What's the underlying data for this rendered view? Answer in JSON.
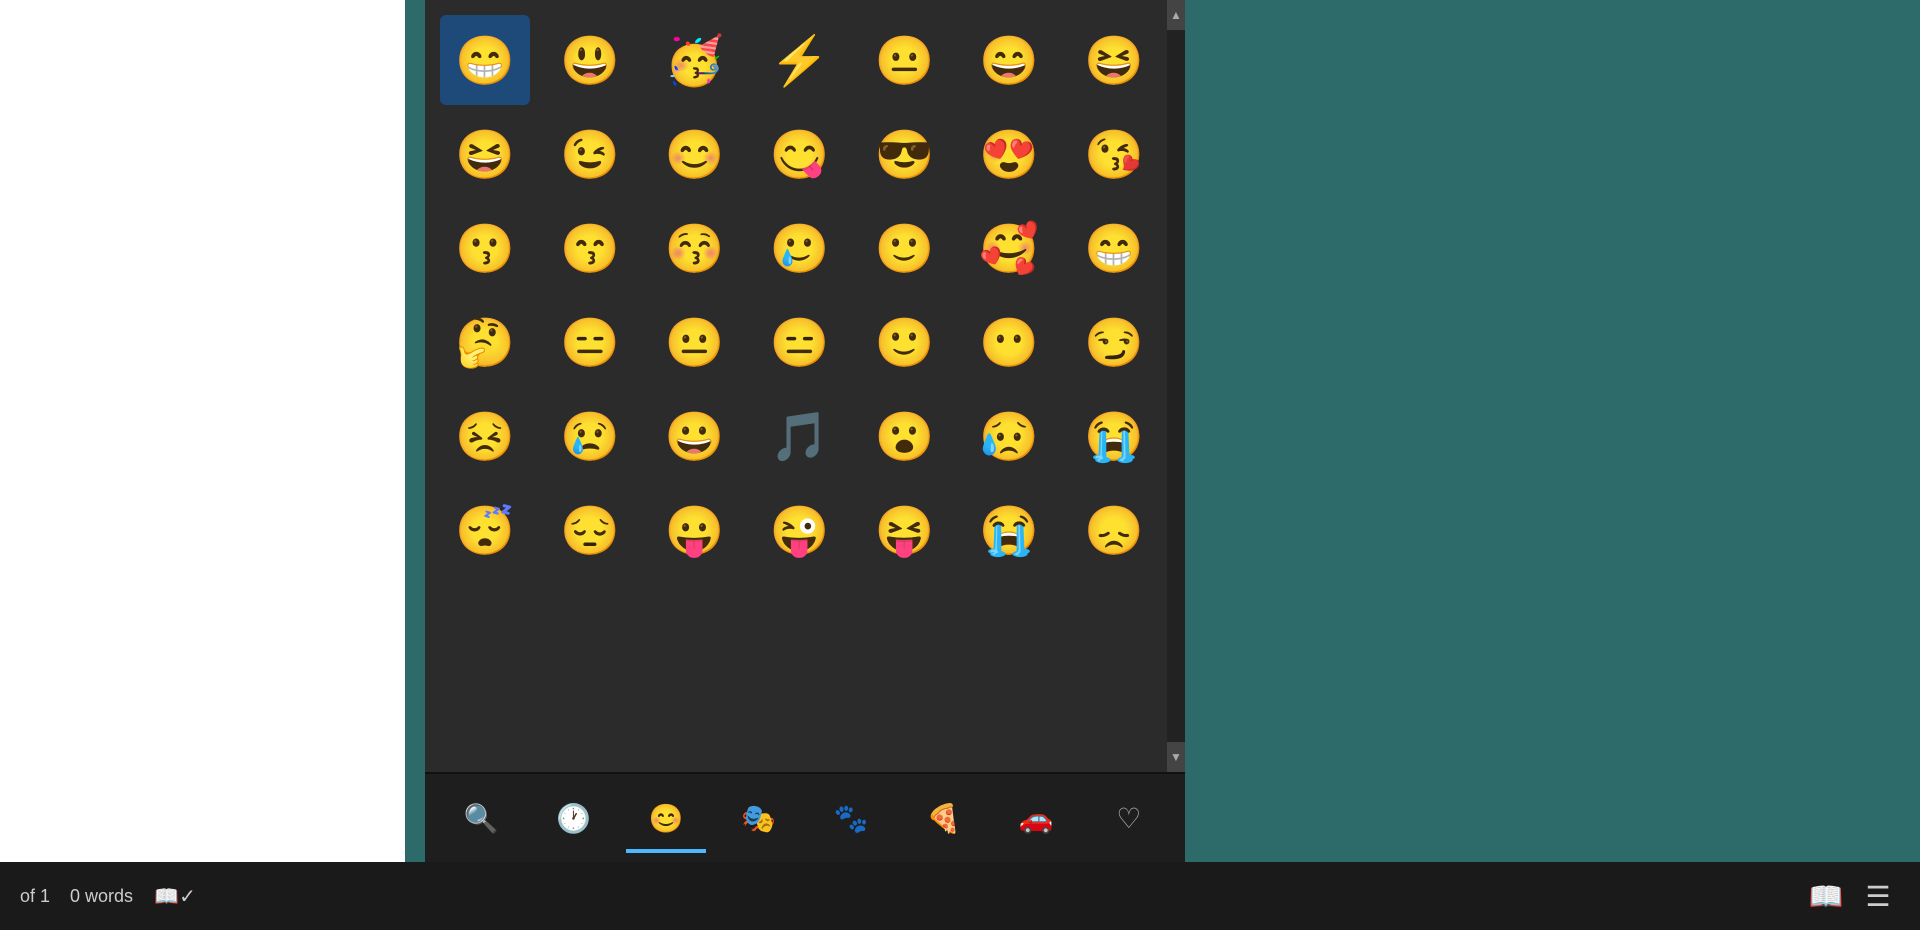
{
  "status_bar": {
    "page_info": "of 1",
    "word_count": "0 words"
  },
  "emoji_panel": {
    "emojis": [
      "😁",
      "😃",
      "🥳",
      "⚡",
      "😐",
      "😄",
      "😆",
      "😆",
      "😉",
      "😊",
      "😋",
      "😎",
      "😍",
      "😘",
      "😗",
      "😙",
      "😚",
      "🥲",
      "🙂",
      "🥰",
      "😁",
      "🤔",
      "😑",
      "😐",
      "😑",
      "🙂",
      "😶",
      "😏",
      "😣",
      "😢",
      "😀",
      "🎵",
      "😮",
      "😥",
      "😭",
      "😴",
      "😔",
      "😛",
      "😜",
      "😝",
      "😭",
      "😞"
    ],
    "categories": [
      {
        "id": "search",
        "symbol": "🔍",
        "label": "Search"
      },
      {
        "id": "recent",
        "symbol": "🕐",
        "label": "Recent"
      },
      {
        "id": "smiley",
        "symbol": "😊",
        "label": "Smileys",
        "active": true
      },
      {
        "id": "people",
        "symbol": "🎭",
        "label": "People"
      },
      {
        "id": "animals",
        "symbol": "🐾",
        "label": "Animals"
      },
      {
        "id": "food",
        "symbol": "🍕",
        "label": "Food"
      },
      {
        "id": "travel",
        "symbol": "🚗",
        "label": "Travel"
      },
      {
        "id": "heart",
        "symbol": "♡",
        "label": "Symbols"
      }
    ]
  }
}
